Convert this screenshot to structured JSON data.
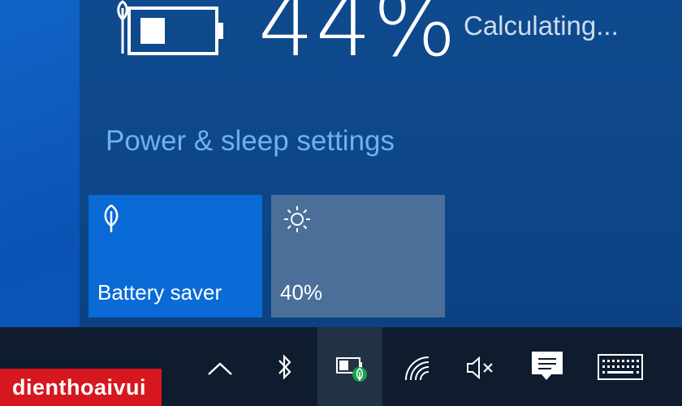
{
  "battery": {
    "percent": "44%",
    "status": "Calculating...",
    "level": 0.44,
    "icon": "battery-charging-leaf-icon"
  },
  "settings_link": "Power & sleep settings",
  "quick_actions": [
    {
      "label": "Battery saver",
      "icon": "leaf-icon",
      "state": "on"
    },
    {
      "label": "40%",
      "icon": "brightness-icon"
    }
  ],
  "taskbar": {
    "icons": [
      "chevron-up-icon",
      "bluetooth-icon",
      "battery-saver-tray-icon",
      "wifi-icon",
      "volume-muted-icon",
      "action-center-icon",
      "touch-keyboard-icon"
    ]
  },
  "watermark": "dienthoaivui",
  "colors": {
    "flyout": "#0d4688",
    "link": "#6fb0f1",
    "tile_on": "#0a6ad6",
    "tile_off": "#4b6f99",
    "taskbar": "#0f1c2e",
    "brand_red": "#d6171f"
  }
}
